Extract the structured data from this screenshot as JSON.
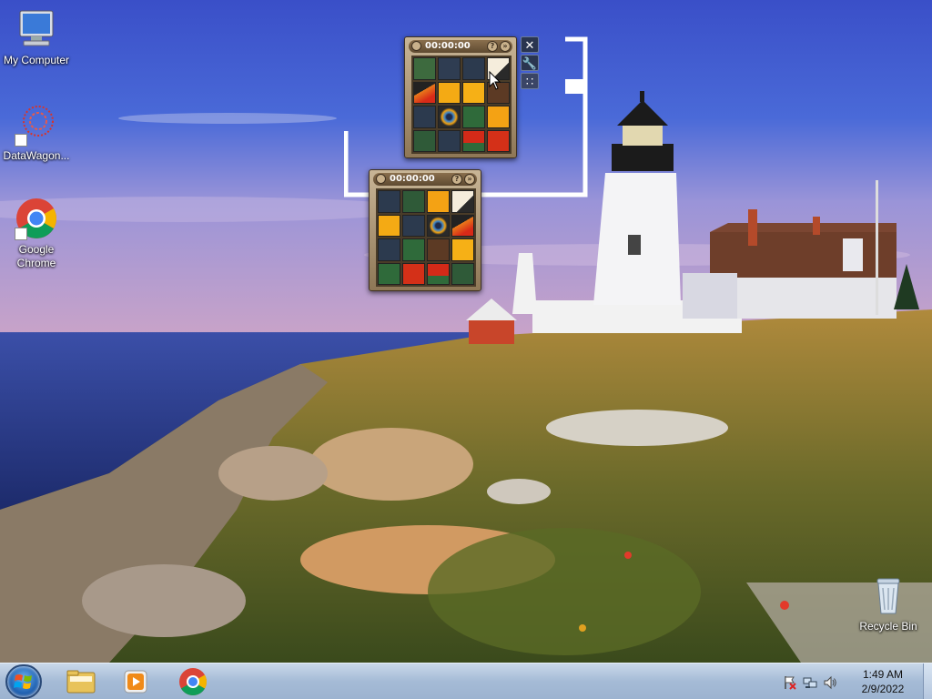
{
  "desktop": {
    "icons": [
      {
        "label": "My Computer"
      },
      {
        "label": "DataWagon..."
      },
      {
        "label": "Google\nChrome"
      },
      {
        "label": "Recycle Bin"
      }
    ]
  },
  "gadget_large": {
    "timer": "00:00:00",
    "help_glyph": "?",
    "option_glyph": "»"
  },
  "gadget_small": {
    "timer": "00:00:00",
    "help_glyph": "?",
    "option_glyph": "»"
  },
  "gadget_tools": {
    "close_glyph": "✕",
    "settings_glyph": "🔧",
    "drag_glyph": "∷"
  },
  "taskbar": {
    "items": [
      "Windows Explorer",
      "Windows Media Player",
      "Google Chrome"
    ],
    "tray": {
      "time": "1:49 AM",
      "date": "2/9/2022"
    }
  },
  "colors": {
    "taskbar": "#a5bbd6",
    "gadget_frame": "#8e7756"
  }
}
